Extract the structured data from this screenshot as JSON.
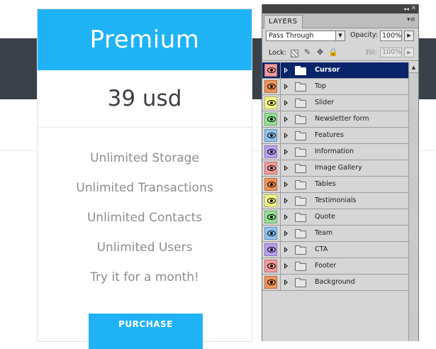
{
  "pricing": {
    "plan_name": "Premium",
    "price": "39 usd",
    "features": [
      "Unlimited Storage",
      "Unlimited Transactions",
      "Unlimited Contacts",
      "Unlimited Users",
      "Try it for a month!"
    ],
    "button_label": "PURCHASE",
    "accent_color": "#1fb3f5"
  },
  "layers_panel": {
    "tab_label": "LAYERS",
    "collapse_glyph": "◂◂",
    "close_glyph": "✕",
    "menu_glyph": "▾≡",
    "blend_mode": "Pass Through",
    "opacity_label": "Opacity:",
    "opacity_value": "100%",
    "lock_label": "Lock:",
    "fill_label": "Fill:",
    "fill_value": "100%",
    "dropdown_glyph": "▼",
    "arrow_glyph": "▶",
    "scroll_up_glyph": "▲",
    "lock_icons": {
      "pixels": "✎",
      "position": "✥",
      "all": "🔒"
    },
    "layers": [
      {
        "name": "Cursor",
        "color": "#f59a9a",
        "selected": true
      },
      {
        "name": "Top",
        "color": "#f0935a",
        "selected": false
      },
      {
        "name": "Slider",
        "color": "#f5f58a",
        "selected": false
      },
      {
        "name": "Newsletter form",
        "color": "#93e093",
        "selected": false
      },
      {
        "name": "Features",
        "color": "#8fc3f0",
        "selected": false
      },
      {
        "name": "Information",
        "color": "#b99ef0",
        "selected": false
      },
      {
        "name": "Image Gallery",
        "color": "#f59a9a",
        "selected": false
      },
      {
        "name": "Tables",
        "color": "#f0935a",
        "selected": false
      },
      {
        "name": "Testimonials",
        "color": "#f5f58a",
        "selected": false
      },
      {
        "name": "Quote",
        "color": "#93e093",
        "selected": false
      },
      {
        "name": "Team",
        "color": "#8fc3f0",
        "selected": false
      },
      {
        "name": "CTA",
        "color": "#b99ef0",
        "selected": false
      },
      {
        "name": "Footer",
        "color": "#f59a9a",
        "selected": false
      },
      {
        "name": "Background",
        "color": "#f0935a",
        "selected": false
      }
    ]
  }
}
